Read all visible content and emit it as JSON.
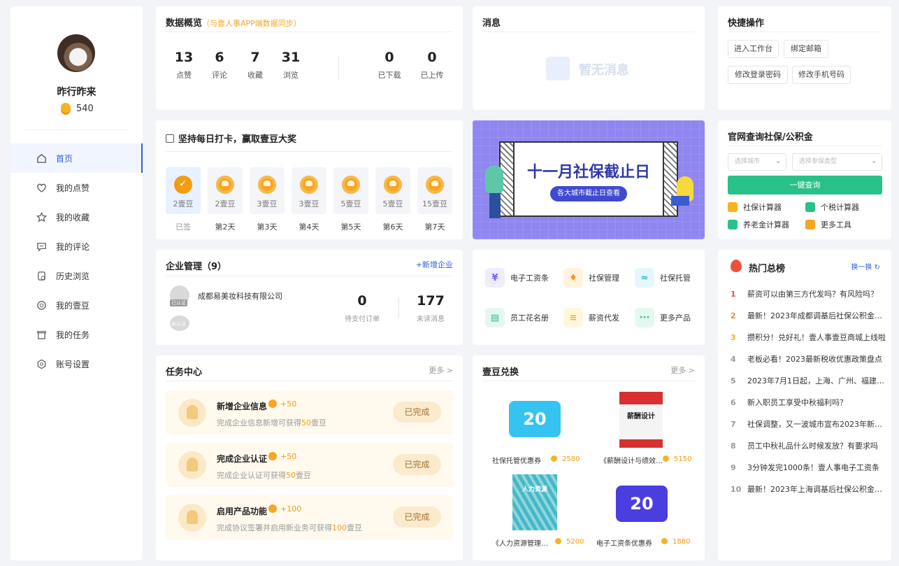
{
  "profile": {
    "name": "昨行昨来",
    "coins": "540"
  },
  "nav": [
    {
      "label": "首页",
      "icon": "home-icon",
      "active": true
    },
    {
      "label": "我的点赞",
      "icon": "heart-icon"
    },
    {
      "label": "我的收藏",
      "icon": "star-icon"
    },
    {
      "label": "我的评论",
      "icon": "comment-icon"
    },
    {
      "label": "历史浏览",
      "icon": "history-icon"
    },
    {
      "label": "我的壹豆",
      "icon": "bean-icon"
    },
    {
      "label": "我的任务",
      "icon": "task-icon"
    },
    {
      "label": "账号设置",
      "icon": "settings-icon"
    }
  ],
  "overview": {
    "title": "数据概览",
    "subtitle": "（与壹人事APP端数据同步）",
    "stats": [
      {
        "n": "13",
        "l": "点赞"
      },
      {
        "n": "6",
        "l": "评论"
      },
      {
        "n": "7",
        "l": "收藏"
      },
      {
        "n": "31",
        "l": "浏览"
      },
      {
        "n": "0",
        "l": "已下载"
      },
      {
        "n": "0",
        "l": "已上传"
      }
    ]
  },
  "messages": {
    "title": "消息",
    "empty": "暂无消息"
  },
  "quick": {
    "title": "快捷操作",
    "buttons": [
      "进入工作台",
      "绑定邮箱",
      "修改登录密码",
      "修改手机号码"
    ]
  },
  "checkin": {
    "title": "坚持每日打卡，赢取壹豆大奖",
    "days": [
      {
        "v": "2壹豆",
        "l": "已签"
      },
      {
        "v": "2壹豆",
        "l": "第2天"
      },
      {
        "v": "3壹豆",
        "l": "第3天"
      },
      {
        "v": "3壹豆",
        "l": "第4天"
      },
      {
        "v": "5壹豆",
        "l": "第5天"
      },
      {
        "v": "5壹豆",
        "l": "第6天"
      },
      {
        "v": "15壹豆",
        "l": "第7天"
      }
    ]
  },
  "banner": {
    "title": "十一月社保截止日",
    "sub": "各大城市截止日查看"
  },
  "query": {
    "title": "官网查询社保/公积金",
    "city_placeholder": "选择城市",
    "type_placeholder": "选择参保类型",
    "go": "一键查询",
    "calcs": [
      "社保计算器",
      "个税计算器",
      "养老金计算器",
      "更多工具"
    ]
  },
  "company": {
    "title": "企业管理（9）",
    "add": "+新增企业",
    "name": "成都易美妆科技有限公司",
    "badge1": "已认证",
    "badge2": "未认证",
    "orders": "0",
    "orders_label": "待支付订单",
    "unread": "177",
    "unread_label": "未读消息"
  },
  "tools": [
    {
      "label": "电子工资条",
      "sym": "¥",
      "color": "#7b5cf5",
      "bg": "#f0ecff"
    },
    {
      "label": "社保管理",
      "sym": "♦",
      "color": "#f39c12",
      "bg": "#fff3e0"
    },
    {
      "label": "社保托管",
      "sym": "≈",
      "color": "#29b6d8",
      "bg": "#e4f7fc"
    },
    {
      "label": "员工花名册",
      "sym": "▤",
      "color": "#29c089",
      "bg": "#e4f8ef"
    },
    {
      "label": "薪资代发",
      "sym": "≡",
      "color": "#f5b323",
      "bg": "#fff6dd"
    },
    {
      "label": "更多产品",
      "sym": "···",
      "color": "#fff",
      "bg": "#29c089"
    }
  ],
  "hot": {
    "title": "热门总榜",
    "refresh": "换一换",
    "items": [
      {
        "n": "1",
        "t": "薪资可以由第三方代发吗？有风险吗？"
      },
      {
        "n": "2",
        "t": "最新！2023年成都调基后社保公积金缴费基数"
      },
      {
        "n": "3",
        "t": "攒积分！兑好礼！壹人事壹豆商城上线啦"
      },
      {
        "n": "4",
        "t": "老板必看！2023最新税收优惠政策盘点"
      },
      {
        "n": "5",
        "t": "2023年7月1日起，上海、广州、福建等地调整"
      },
      {
        "n": "6",
        "t": "新入职员工享受中秋福利吗？"
      },
      {
        "n": "7",
        "t": "社保调整，又一波城市宣布2023年新标准"
      },
      {
        "n": "8",
        "t": "员工中秋礼品什么时候发放？有要求吗"
      },
      {
        "n": "9",
        "t": "3分钟发完1000条！壹人事电子工资条"
      },
      {
        "n": "10",
        "t": "最新！2023年上海调基后社保公积金缴费基数"
      }
    ]
  },
  "tasks": {
    "title": "任务中心",
    "more": "更多 >",
    "items": [
      {
        "t": "新增企业信息",
        "p": "+50",
        "d1": "完成企业信息新增可获得",
        "d2": "50",
        "d3": "壹豆",
        "b": "已完成"
      },
      {
        "t": "完成企业认证",
        "p": "+50",
        "d1": "完成企业认证可获得",
        "d2": "50",
        "d3": "壹豆",
        "b": "已完成"
      },
      {
        "t": "启用产品功能",
        "p": "+100",
        "d1": "完成协议签署并启用新业务可获得",
        "d2": "100",
        "d3": "壹豆",
        "b": "已完成"
      }
    ]
  },
  "exchange": {
    "title": "壹豆兑换",
    "more": "更多 >",
    "items": [
      {
        "name": "社保托管优惠券",
        "price": "2580",
        "img": "20"
      },
      {
        "name": "《薪酬设计与绩效考核全案》",
        "price": "5150",
        "img": "薪酬设计"
      },
      {
        "name": "《人力资源管理实务》",
        "price": "5200",
        "img": "人力资源"
      },
      {
        "name": "电子工资条优惠券",
        "price": "1880",
        "img": "20"
      }
    ]
  }
}
